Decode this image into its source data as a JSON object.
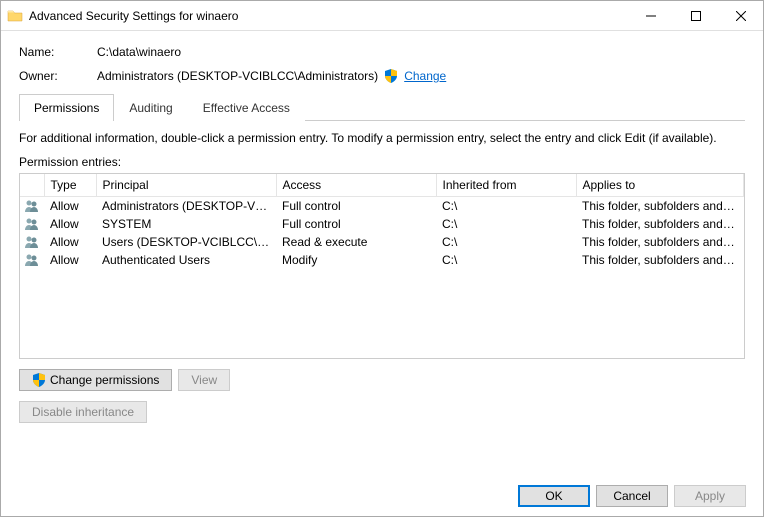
{
  "window": {
    "title": "Advanced Security Settings for winaero"
  },
  "header": {
    "nameLabel": "Name:",
    "nameValue": "C:\\data\\winaero",
    "ownerLabel": "Owner:",
    "ownerValue": "Administrators (DESKTOP-VCIBLCC\\Administrators)",
    "changeLink": "Change"
  },
  "tabs": [
    {
      "label": "Permissions",
      "active": true
    },
    {
      "label": "Auditing",
      "active": false
    },
    {
      "label": "Effective Access",
      "active": false
    }
  ],
  "infoText": "For additional information, double-click a permission entry. To modify a permission entry, select the entry and click Edit (if available).",
  "sectionLabel": "Permission entries:",
  "table": {
    "columns": [
      "",
      "Type",
      "Principal",
      "Access",
      "Inherited from",
      "Applies to"
    ],
    "rows": [
      {
        "type": "Allow",
        "principal": "Administrators (DESKTOP-VCI...",
        "access": "Full control",
        "inherited": "C:\\",
        "applies": "This folder, subfolders and files"
      },
      {
        "type": "Allow",
        "principal": "SYSTEM",
        "access": "Full control",
        "inherited": "C:\\",
        "applies": "This folder, subfolders and files"
      },
      {
        "type": "Allow",
        "principal": "Users (DESKTOP-VCIBLCC\\Us...",
        "access": "Read & execute",
        "inherited": "C:\\",
        "applies": "This folder, subfolders and files"
      },
      {
        "type": "Allow",
        "principal": "Authenticated Users",
        "access": "Modify",
        "inherited": "C:\\",
        "applies": "This folder, subfolders and files"
      }
    ]
  },
  "buttons": {
    "changePermissions": "Change permissions",
    "view": "View",
    "disableInheritance": "Disable inheritance",
    "ok": "OK",
    "cancel": "Cancel",
    "apply": "Apply"
  }
}
